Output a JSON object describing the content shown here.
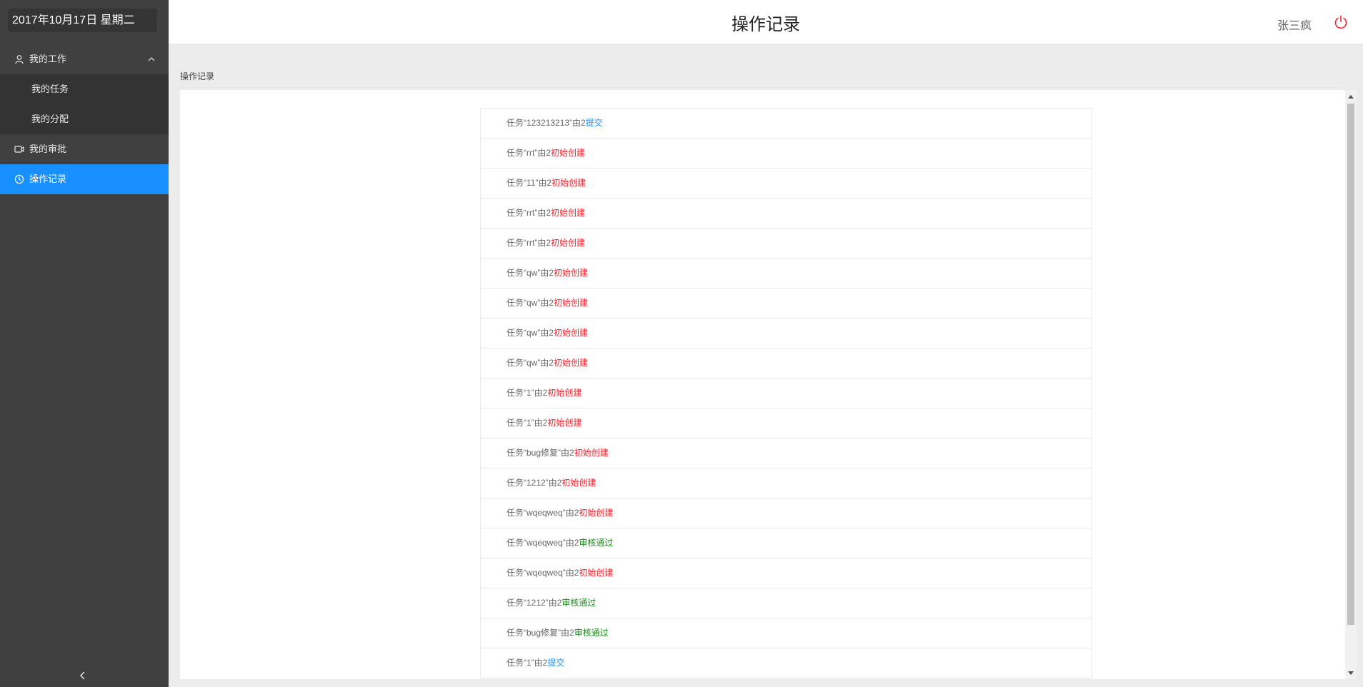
{
  "sidebar": {
    "date": "2017年10月17日 星期二",
    "menu": {
      "my_work": "我的工作",
      "my_tasks": "我的任务",
      "my_assign": "我的分配",
      "my_approval": "我的审批",
      "op_records": "操作记录"
    }
  },
  "header": {
    "title": "操作记录",
    "user": "张三疯"
  },
  "breadcrumb": "操作记录",
  "records": [
    {
      "prefix": "任务“123213213”由2",
      "action": "提交",
      "color": "#1890ff"
    },
    {
      "prefix": "任务“rrt”由2",
      "action": "初始创建",
      "color": "#f5222d"
    },
    {
      "prefix": "任务“11”由2",
      "action": "初始创建",
      "color": "#f5222d"
    },
    {
      "prefix": "任务“rrt”由2",
      "action": "初始创建",
      "color": "#f5222d"
    },
    {
      "prefix": "任务“rrt”由2",
      "action": "初始创建",
      "color": "#f5222d"
    },
    {
      "prefix": "任务“qw”由2",
      "action": "初始创建",
      "color": "#f5222d"
    },
    {
      "prefix": "任务“qw”由2",
      "action": "初始创建",
      "color": "#f5222d"
    },
    {
      "prefix": "任务“qw”由2",
      "action": "初始创建",
      "color": "#f5222d"
    },
    {
      "prefix": "任务“qw”由2",
      "action": "初始创建",
      "color": "#f5222d"
    },
    {
      "prefix": "任务“1”由2",
      "action": "初始创建",
      "color": "#f5222d"
    },
    {
      "prefix": "任务“1”由2",
      "action": "初始创建",
      "color": "#f5222d"
    },
    {
      "prefix": "任务“bug修复”由2",
      "action": "初始创建",
      "color": "#f5222d"
    },
    {
      "prefix": "任务“1212”由2",
      "action": "初始创建",
      "color": "#f5222d"
    },
    {
      "prefix": "任务“wqeqweq”由2",
      "action": "初始创建",
      "color": "#f5222d"
    },
    {
      "prefix": "任务“wqeqweq”由2",
      "action": "审核通过",
      "color": "#1f8a1f"
    },
    {
      "prefix": "任务“wqeqweq”由2",
      "action": "初始创建",
      "color": "#f5222d"
    },
    {
      "prefix": "任务“1212”由2",
      "action": "审核通过",
      "color": "#1f8a1f"
    },
    {
      "prefix": "任务“bug修复”由2",
      "action": "审核通过",
      "color": "#1f8a1f"
    },
    {
      "prefix": "任务“1”由2",
      "action": "提交",
      "color": "#1890ff"
    }
  ],
  "colors": {
    "sidebar_bg": "#404040",
    "submenu_bg": "#333333",
    "active": "#1890ff",
    "power_icon": "#f5222d"
  },
  "icons": {
    "my_work": "user-icon",
    "my_approval": "video-icon",
    "op_records": "clock-icon",
    "logout": "power-icon",
    "collapse": "chevron-left-icon"
  }
}
